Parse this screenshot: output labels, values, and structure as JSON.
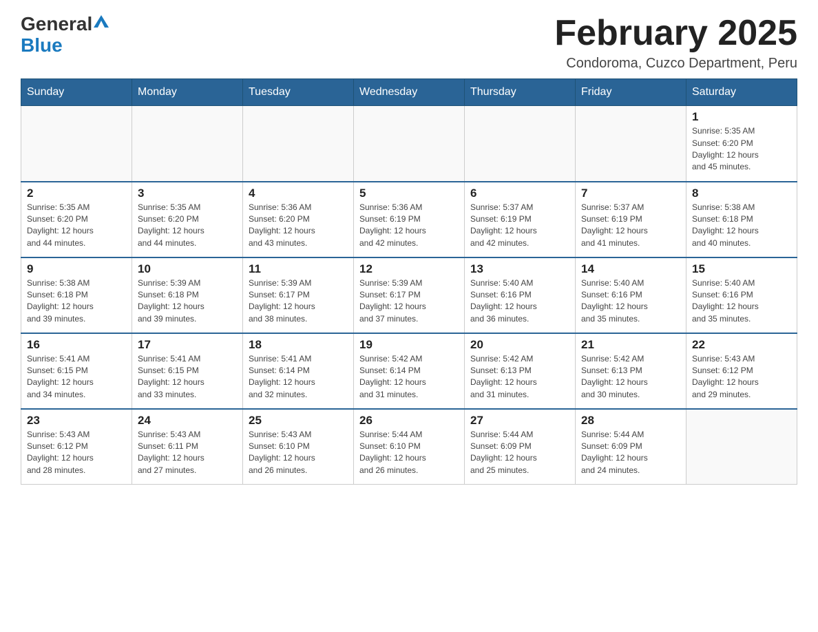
{
  "logo": {
    "general": "General",
    "blue": "Blue",
    "triangle_symbol": "▲"
  },
  "title": {
    "month": "February 2025",
    "location": "Condoroma, Cuzco Department, Peru"
  },
  "weekdays": [
    "Sunday",
    "Monday",
    "Tuesday",
    "Wednesday",
    "Thursday",
    "Friday",
    "Saturday"
  ],
  "weeks": [
    [
      {
        "day": "",
        "info": ""
      },
      {
        "day": "",
        "info": ""
      },
      {
        "day": "",
        "info": ""
      },
      {
        "day": "",
        "info": ""
      },
      {
        "day": "",
        "info": ""
      },
      {
        "day": "",
        "info": ""
      },
      {
        "day": "1",
        "info": "Sunrise: 5:35 AM\nSunset: 6:20 PM\nDaylight: 12 hours\nand 45 minutes."
      }
    ],
    [
      {
        "day": "2",
        "info": "Sunrise: 5:35 AM\nSunset: 6:20 PM\nDaylight: 12 hours\nand 44 minutes."
      },
      {
        "day": "3",
        "info": "Sunrise: 5:35 AM\nSunset: 6:20 PM\nDaylight: 12 hours\nand 44 minutes."
      },
      {
        "day": "4",
        "info": "Sunrise: 5:36 AM\nSunset: 6:20 PM\nDaylight: 12 hours\nand 43 minutes."
      },
      {
        "day": "5",
        "info": "Sunrise: 5:36 AM\nSunset: 6:19 PM\nDaylight: 12 hours\nand 42 minutes."
      },
      {
        "day": "6",
        "info": "Sunrise: 5:37 AM\nSunset: 6:19 PM\nDaylight: 12 hours\nand 42 minutes."
      },
      {
        "day": "7",
        "info": "Sunrise: 5:37 AM\nSunset: 6:19 PM\nDaylight: 12 hours\nand 41 minutes."
      },
      {
        "day": "8",
        "info": "Sunrise: 5:38 AM\nSunset: 6:18 PM\nDaylight: 12 hours\nand 40 minutes."
      }
    ],
    [
      {
        "day": "9",
        "info": "Sunrise: 5:38 AM\nSunset: 6:18 PM\nDaylight: 12 hours\nand 39 minutes."
      },
      {
        "day": "10",
        "info": "Sunrise: 5:39 AM\nSunset: 6:18 PM\nDaylight: 12 hours\nand 39 minutes."
      },
      {
        "day": "11",
        "info": "Sunrise: 5:39 AM\nSunset: 6:17 PM\nDaylight: 12 hours\nand 38 minutes."
      },
      {
        "day": "12",
        "info": "Sunrise: 5:39 AM\nSunset: 6:17 PM\nDaylight: 12 hours\nand 37 minutes."
      },
      {
        "day": "13",
        "info": "Sunrise: 5:40 AM\nSunset: 6:16 PM\nDaylight: 12 hours\nand 36 minutes."
      },
      {
        "day": "14",
        "info": "Sunrise: 5:40 AM\nSunset: 6:16 PM\nDaylight: 12 hours\nand 35 minutes."
      },
      {
        "day": "15",
        "info": "Sunrise: 5:40 AM\nSunset: 6:16 PM\nDaylight: 12 hours\nand 35 minutes."
      }
    ],
    [
      {
        "day": "16",
        "info": "Sunrise: 5:41 AM\nSunset: 6:15 PM\nDaylight: 12 hours\nand 34 minutes."
      },
      {
        "day": "17",
        "info": "Sunrise: 5:41 AM\nSunset: 6:15 PM\nDaylight: 12 hours\nand 33 minutes."
      },
      {
        "day": "18",
        "info": "Sunrise: 5:41 AM\nSunset: 6:14 PM\nDaylight: 12 hours\nand 32 minutes."
      },
      {
        "day": "19",
        "info": "Sunrise: 5:42 AM\nSunset: 6:14 PM\nDaylight: 12 hours\nand 31 minutes."
      },
      {
        "day": "20",
        "info": "Sunrise: 5:42 AM\nSunset: 6:13 PM\nDaylight: 12 hours\nand 31 minutes."
      },
      {
        "day": "21",
        "info": "Sunrise: 5:42 AM\nSunset: 6:13 PM\nDaylight: 12 hours\nand 30 minutes."
      },
      {
        "day": "22",
        "info": "Sunrise: 5:43 AM\nSunset: 6:12 PM\nDaylight: 12 hours\nand 29 minutes."
      }
    ],
    [
      {
        "day": "23",
        "info": "Sunrise: 5:43 AM\nSunset: 6:12 PM\nDaylight: 12 hours\nand 28 minutes."
      },
      {
        "day": "24",
        "info": "Sunrise: 5:43 AM\nSunset: 6:11 PM\nDaylight: 12 hours\nand 27 minutes."
      },
      {
        "day": "25",
        "info": "Sunrise: 5:43 AM\nSunset: 6:10 PM\nDaylight: 12 hours\nand 26 minutes."
      },
      {
        "day": "26",
        "info": "Sunrise: 5:44 AM\nSunset: 6:10 PM\nDaylight: 12 hours\nand 26 minutes."
      },
      {
        "day": "27",
        "info": "Sunrise: 5:44 AM\nSunset: 6:09 PM\nDaylight: 12 hours\nand 25 minutes."
      },
      {
        "day": "28",
        "info": "Sunrise: 5:44 AM\nSunset: 6:09 PM\nDaylight: 12 hours\nand 24 minutes."
      },
      {
        "day": "",
        "info": ""
      }
    ]
  ]
}
